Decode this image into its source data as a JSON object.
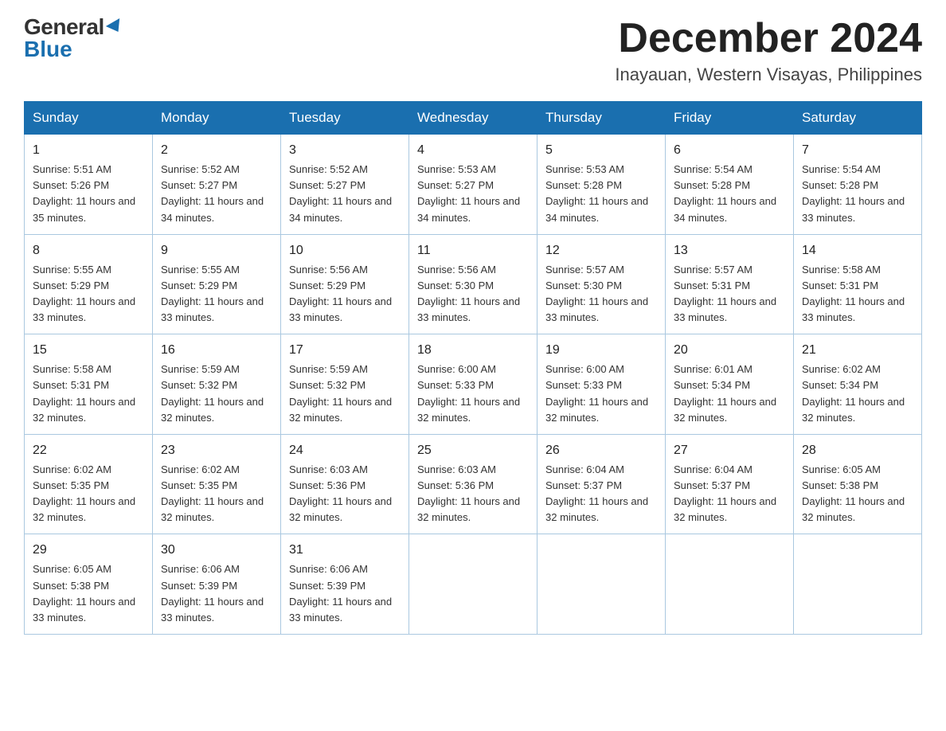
{
  "logo": {
    "general": "General",
    "blue": "Blue"
  },
  "header": {
    "month": "December 2024",
    "location": "Inayauan, Western Visayas, Philippines"
  },
  "weekdays": [
    "Sunday",
    "Monday",
    "Tuesday",
    "Wednesday",
    "Thursday",
    "Friday",
    "Saturday"
  ],
  "weeks": [
    [
      {
        "day": "1",
        "sunrise": "5:51 AM",
        "sunset": "5:26 PM",
        "daylight": "11 hours and 35 minutes."
      },
      {
        "day": "2",
        "sunrise": "5:52 AM",
        "sunset": "5:27 PM",
        "daylight": "11 hours and 34 minutes."
      },
      {
        "day": "3",
        "sunrise": "5:52 AM",
        "sunset": "5:27 PM",
        "daylight": "11 hours and 34 minutes."
      },
      {
        "day": "4",
        "sunrise": "5:53 AM",
        "sunset": "5:27 PM",
        "daylight": "11 hours and 34 minutes."
      },
      {
        "day": "5",
        "sunrise": "5:53 AM",
        "sunset": "5:28 PM",
        "daylight": "11 hours and 34 minutes."
      },
      {
        "day": "6",
        "sunrise": "5:54 AM",
        "sunset": "5:28 PM",
        "daylight": "11 hours and 34 minutes."
      },
      {
        "day": "7",
        "sunrise": "5:54 AM",
        "sunset": "5:28 PM",
        "daylight": "11 hours and 33 minutes."
      }
    ],
    [
      {
        "day": "8",
        "sunrise": "5:55 AM",
        "sunset": "5:29 PM",
        "daylight": "11 hours and 33 minutes."
      },
      {
        "day": "9",
        "sunrise": "5:55 AM",
        "sunset": "5:29 PM",
        "daylight": "11 hours and 33 minutes."
      },
      {
        "day": "10",
        "sunrise": "5:56 AM",
        "sunset": "5:29 PM",
        "daylight": "11 hours and 33 minutes."
      },
      {
        "day": "11",
        "sunrise": "5:56 AM",
        "sunset": "5:30 PM",
        "daylight": "11 hours and 33 minutes."
      },
      {
        "day": "12",
        "sunrise": "5:57 AM",
        "sunset": "5:30 PM",
        "daylight": "11 hours and 33 minutes."
      },
      {
        "day": "13",
        "sunrise": "5:57 AM",
        "sunset": "5:31 PM",
        "daylight": "11 hours and 33 minutes."
      },
      {
        "day": "14",
        "sunrise": "5:58 AM",
        "sunset": "5:31 PM",
        "daylight": "11 hours and 33 minutes."
      }
    ],
    [
      {
        "day": "15",
        "sunrise": "5:58 AM",
        "sunset": "5:31 PM",
        "daylight": "11 hours and 32 minutes."
      },
      {
        "day": "16",
        "sunrise": "5:59 AM",
        "sunset": "5:32 PM",
        "daylight": "11 hours and 32 minutes."
      },
      {
        "day": "17",
        "sunrise": "5:59 AM",
        "sunset": "5:32 PM",
        "daylight": "11 hours and 32 minutes."
      },
      {
        "day": "18",
        "sunrise": "6:00 AM",
        "sunset": "5:33 PM",
        "daylight": "11 hours and 32 minutes."
      },
      {
        "day": "19",
        "sunrise": "6:00 AM",
        "sunset": "5:33 PM",
        "daylight": "11 hours and 32 minutes."
      },
      {
        "day": "20",
        "sunrise": "6:01 AM",
        "sunset": "5:34 PM",
        "daylight": "11 hours and 32 minutes."
      },
      {
        "day": "21",
        "sunrise": "6:02 AM",
        "sunset": "5:34 PM",
        "daylight": "11 hours and 32 minutes."
      }
    ],
    [
      {
        "day": "22",
        "sunrise": "6:02 AM",
        "sunset": "5:35 PM",
        "daylight": "11 hours and 32 minutes."
      },
      {
        "day": "23",
        "sunrise": "6:02 AM",
        "sunset": "5:35 PM",
        "daylight": "11 hours and 32 minutes."
      },
      {
        "day": "24",
        "sunrise": "6:03 AM",
        "sunset": "5:36 PM",
        "daylight": "11 hours and 32 minutes."
      },
      {
        "day": "25",
        "sunrise": "6:03 AM",
        "sunset": "5:36 PM",
        "daylight": "11 hours and 32 minutes."
      },
      {
        "day": "26",
        "sunrise": "6:04 AM",
        "sunset": "5:37 PM",
        "daylight": "11 hours and 32 minutes."
      },
      {
        "day": "27",
        "sunrise": "6:04 AM",
        "sunset": "5:37 PM",
        "daylight": "11 hours and 32 minutes."
      },
      {
        "day": "28",
        "sunrise": "6:05 AM",
        "sunset": "5:38 PM",
        "daylight": "11 hours and 32 minutes."
      }
    ],
    [
      {
        "day": "29",
        "sunrise": "6:05 AM",
        "sunset": "5:38 PM",
        "daylight": "11 hours and 33 minutes."
      },
      {
        "day": "30",
        "sunrise": "6:06 AM",
        "sunset": "5:39 PM",
        "daylight": "11 hours and 33 minutes."
      },
      {
        "day": "31",
        "sunrise": "6:06 AM",
        "sunset": "5:39 PM",
        "daylight": "11 hours and 33 minutes."
      },
      null,
      null,
      null,
      null
    ]
  ]
}
